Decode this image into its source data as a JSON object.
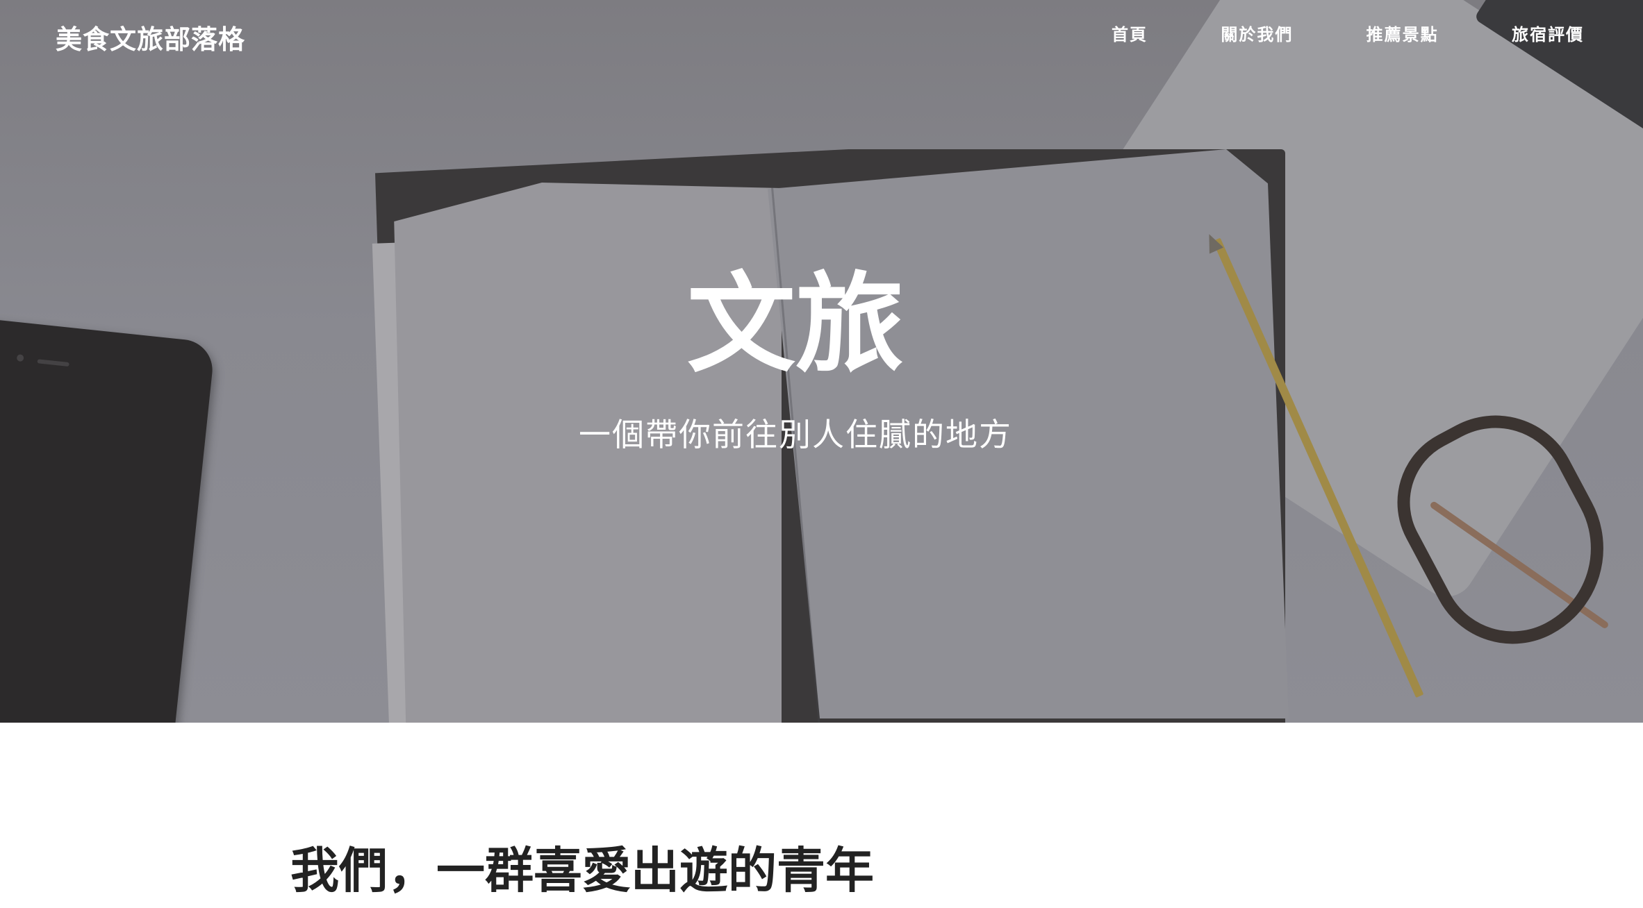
{
  "nav": {
    "brand": "美食文旅部落格",
    "links": [
      {
        "label": "首頁"
      },
      {
        "label": "關於我們"
      },
      {
        "label": "推薦景點"
      },
      {
        "label": "旅宿評價"
      }
    ]
  },
  "hero": {
    "title": "文旅",
    "subtitle": "一個帶你前往別人住膩的地方"
  },
  "content": {
    "heading": "我們，一群喜愛出遊的青年"
  }
}
